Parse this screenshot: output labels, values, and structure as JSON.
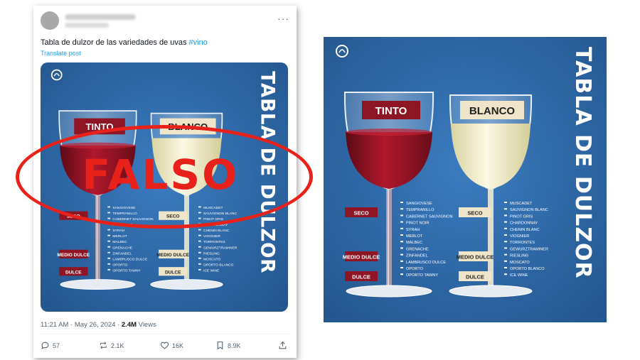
{
  "tweet": {
    "text": "Tabla de dulzor de las variedades de uvas ",
    "hashtag": "#vino",
    "translate": "Translate post",
    "time": "11:21 AM · May 26, 2024 · ",
    "views_count": "2.4M",
    "views_label": " Views",
    "more": "···",
    "actions": {
      "replies": "57",
      "reposts": "2.1K",
      "likes": "16K",
      "bookmarks": "8.9K"
    }
  },
  "stamp": {
    "text": "FALSO"
  },
  "poster": {
    "title": "TABLA DE DULZOR",
    "glass_red_label": "TINTO",
    "glass_white_label": "BLANCO",
    "levels": {
      "dry": "SECO",
      "semi": "MEDIO DULCE",
      "sweet": "DULCE"
    },
    "red_varieties": [
      "SANGIOVESE",
      "TEMPRANILLO",
      "CABERNET SAUVIGNON",
      "PINOT NOIR",
      "SYRAH",
      "MERLOT",
      "MALBEC",
      "GRENACHE",
      "ZINFANDEL",
      "LAMBRUSCO DULCE",
      "OPORTO",
      "OPORTO TAWNY"
    ],
    "white_varieties": [
      "MUSCADET",
      "SAUVIGNON BLANC",
      "PINOT GRIS",
      "CHARDONNAY",
      "CHENIN BLANC",
      "VIOGNIER",
      "TORRONTES",
      "GEWURZTRAMINER",
      "RIESLING",
      "MOSCATO",
      "OPORTO BLANCO",
      "ICE WINE"
    ],
    "colors": {
      "background": "#2f6aa6",
      "red_wine": "#9b1327",
      "white_wine": "#f3efcc",
      "label_red": "#8e1624",
      "label_cream": "#efe6c9",
      "stamp": "#e8221b"
    }
  }
}
